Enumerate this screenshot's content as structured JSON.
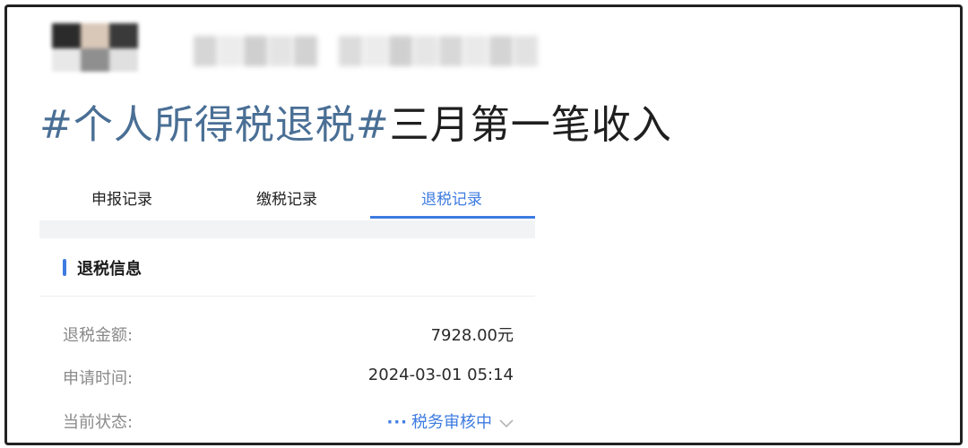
{
  "post": {
    "hashtag": "#个人所得税退税#",
    "title_rest": "三月第一笔收入"
  },
  "tabs": [
    {
      "label": "申报记录",
      "active": false
    },
    {
      "label": "缴税记录",
      "active": false
    },
    {
      "label": "退税记录",
      "active": true
    }
  ],
  "section": {
    "title": "退税信息"
  },
  "fields": {
    "refund_amount": {
      "label": "退税金额:",
      "value": "7928.00元"
    },
    "apply_time": {
      "label": "申请时间:",
      "value": "2024-03-01 05:14"
    },
    "status": {
      "label": "当前状态:",
      "dots": "···",
      "value": "税务审核中",
      "icon": "chevron-down-icon"
    }
  },
  "colors": {
    "accent": "#3d7be0",
    "hashtag": "#4a6f95",
    "label_gray": "#8a8a8a",
    "divider_bg": "#f2f3f5"
  }
}
